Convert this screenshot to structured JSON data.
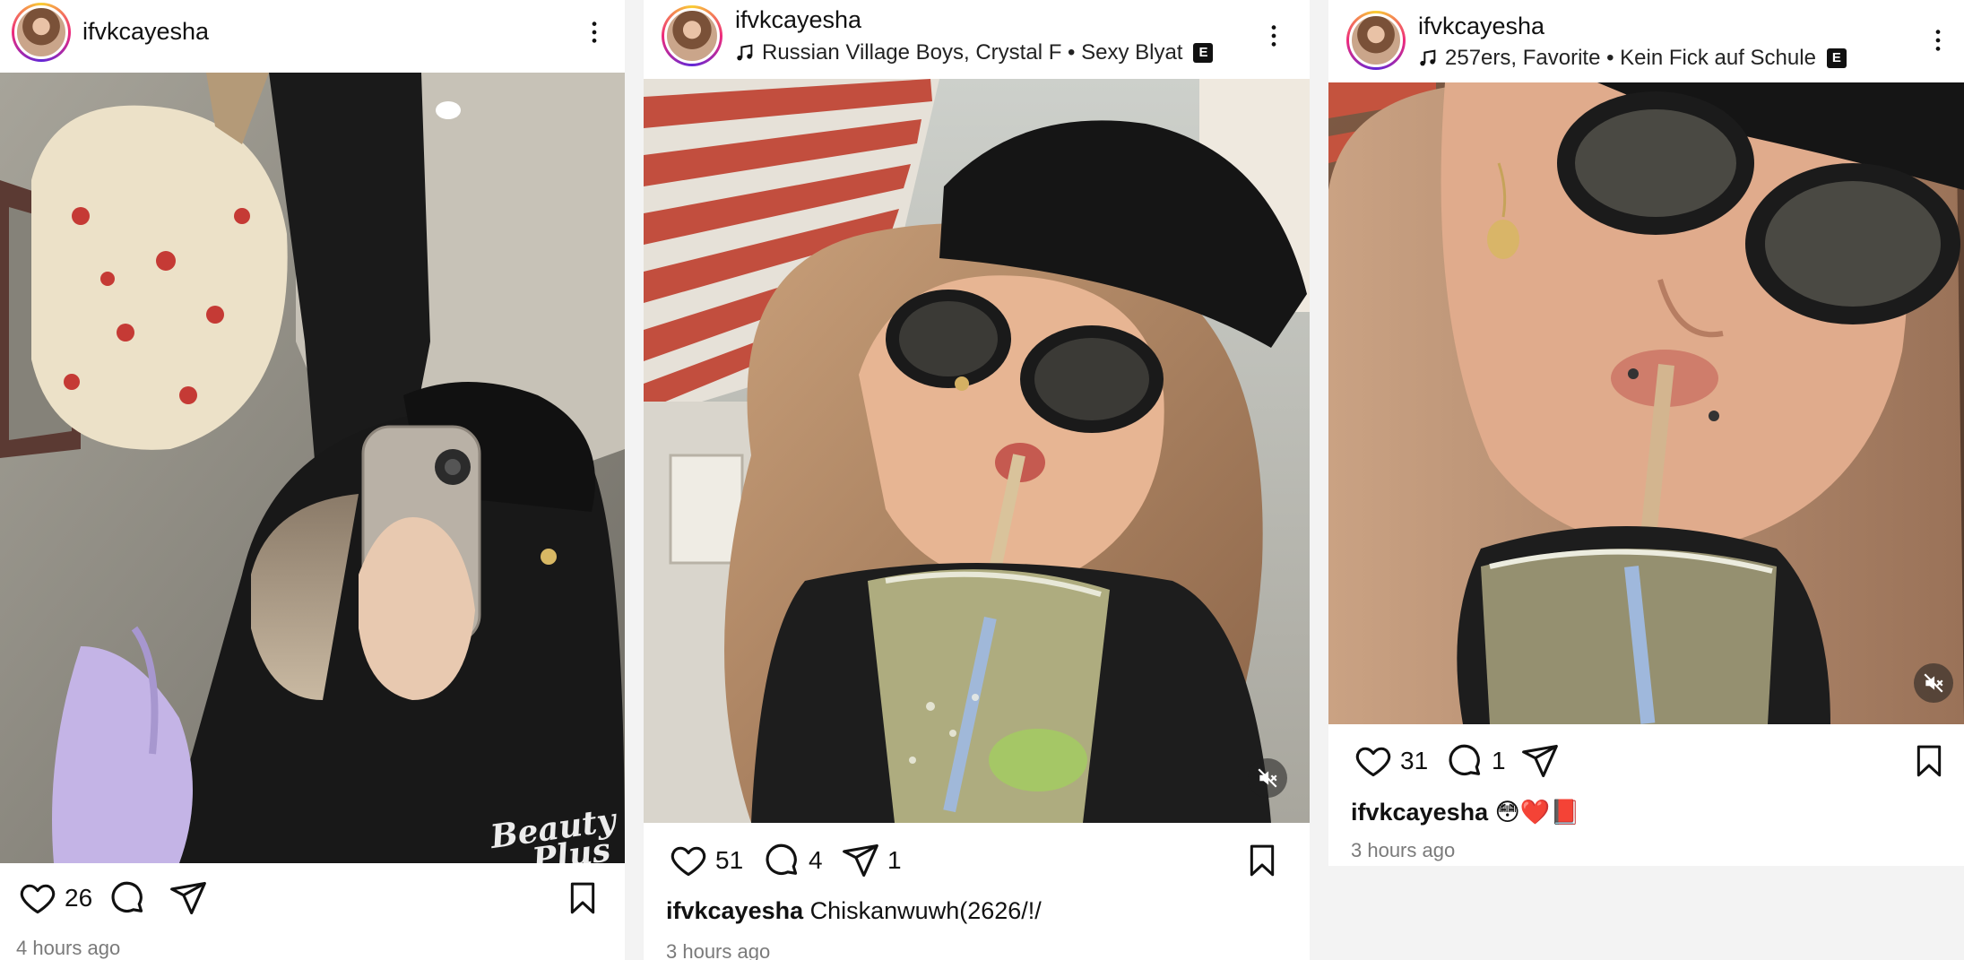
{
  "posts": [
    {
      "username": "ifvkcayesha",
      "music": null,
      "likes": "26",
      "comments": "",
      "shares": "",
      "caption": "",
      "time": "4 hours ago",
      "watermark": "Beauty Plus",
      "has_mute_button": false
    },
    {
      "username": "ifvkcayesha",
      "music": "Russian Village Boys, Crystal F • Sexy Blyat",
      "explicit_badge": "E",
      "likes": "51",
      "comments": "4",
      "shares": "1",
      "caption_user": "ifvkcayesha",
      "caption": "Chiskanwuwh(2626/!/",
      "time": "3 hours ago",
      "has_mute_button": true
    },
    {
      "username": "ifvkcayesha",
      "music": "257ers, Favorite • Kein Fick auf Schule",
      "explicit_badge": "E",
      "likes": "31",
      "comments": "1",
      "shares": "",
      "caption_user": "ifvkcayesha",
      "caption": "😳❤️📕",
      "time": "3 hours ago",
      "has_mute_button": true
    }
  ],
  "icons": [
    "music-note-icon",
    "more-options-icon",
    "heart-icon",
    "comment-icon",
    "share-icon",
    "bookmark-icon",
    "mute-icon"
  ],
  "colors": {
    "text": "#111111",
    "muted": "#7a7a7a",
    "avatar_ring": [
      "#f9ce34",
      "#ee2a7b",
      "#6228d7"
    ]
  }
}
